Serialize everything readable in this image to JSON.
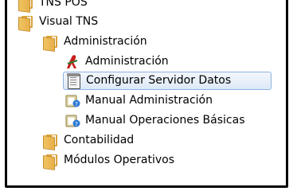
{
  "tree": {
    "items": [
      {
        "label": "TNS POS",
        "icon": "folder-icon",
        "indent": 0
      },
      {
        "label": "Visual TNS",
        "icon": "folder-icon",
        "indent": 0
      },
      {
        "label": "Administración",
        "icon": "folder-icon",
        "indent": 1
      },
      {
        "label": "Administración",
        "icon": "admin-app-icon",
        "indent": 2
      },
      {
        "label": "Configurar Servidor Datos",
        "icon": "config-document-icon",
        "indent": 2,
        "selected": true
      },
      {
        "label": "Manual Administración",
        "icon": "help-manual-icon",
        "indent": 2
      },
      {
        "label": "Manual Operaciones Básicas",
        "icon": "help-manual-icon",
        "indent": 2
      },
      {
        "label": "Contabilidad",
        "icon": "folder-icon",
        "indent": 1
      },
      {
        "label": "Módulos Operativos",
        "icon": "folder-icon",
        "indent": 1
      }
    ]
  },
  "colors": {
    "folder": "#e7b04a",
    "selection_border": "#8db2e3",
    "selection_fill": "#dde9f7"
  }
}
